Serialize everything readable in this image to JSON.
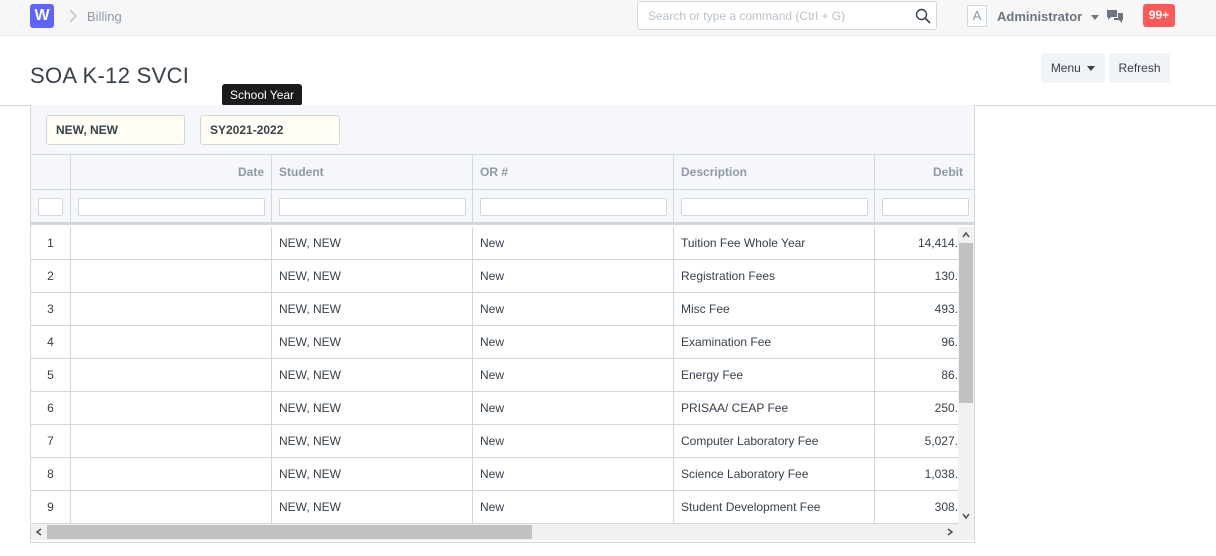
{
  "navbar": {
    "logo": "W",
    "breadcrumb": "Billing",
    "search_placeholder": "Search or type a command (Ctrl + G)",
    "avatar_letter": "A",
    "user_name": "Administrator",
    "notifications": "99+"
  },
  "page": {
    "title": "SOA K-12 SVCI",
    "menu_label": "Menu",
    "refresh_label": "Refresh"
  },
  "filters": {
    "student": "NEW, NEW",
    "school_year": "SY2021-2022",
    "tooltip": "School Year"
  },
  "grid": {
    "columns": [
      "",
      "Date",
      "Student",
      "OR #",
      "Description",
      "Debit"
    ],
    "rows": [
      {
        "n": "1",
        "date": "",
        "student": "NEW, NEW",
        "or": "New",
        "desc": "Tuition Fee Whole Year",
        "debit": "14,414."
      },
      {
        "n": "2",
        "date": "",
        "student": "NEW, NEW",
        "or": "New",
        "desc": "Registration Fees",
        "debit": "130."
      },
      {
        "n": "3",
        "date": "",
        "student": "NEW, NEW",
        "or": "New",
        "desc": "Misc Fee",
        "debit": "493."
      },
      {
        "n": "4",
        "date": "",
        "student": "NEW, NEW",
        "or": "New",
        "desc": "Examination Fee",
        "debit": "96."
      },
      {
        "n": "5",
        "date": "",
        "student": "NEW, NEW",
        "or": "New",
        "desc": "Energy Fee",
        "debit": "86."
      },
      {
        "n": "6",
        "date": "",
        "student": "NEW, NEW",
        "or": "New",
        "desc": "PRISAA/ CEAP Fee",
        "debit": "250."
      },
      {
        "n": "7",
        "date": "",
        "student": "NEW, NEW",
        "or": "New",
        "desc": "Computer Laboratory Fee",
        "debit": "5,027."
      },
      {
        "n": "8",
        "date": "",
        "student": "NEW, NEW",
        "or": "New",
        "desc": "Science Laboratory Fee",
        "debit": "1,038."
      },
      {
        "n": "9",
        "date": "",
        "student": "NEW, NEW",
        "or": "New",
        "desc": "Student Development Fee",
        "debit": "308."
      }
    ]
  },
  "colors": {
    "accent": "#5e64ff",
    "notification": "#ff5858",
    "filter_bg": "#fffdf4"
  },
  "icons": [
    "logo-icon",
    "chevron-right-icon",
    "search-icon",
    "avatar-icon",
    "caret-down-icon",
    "chat-icon"
  ]
}
